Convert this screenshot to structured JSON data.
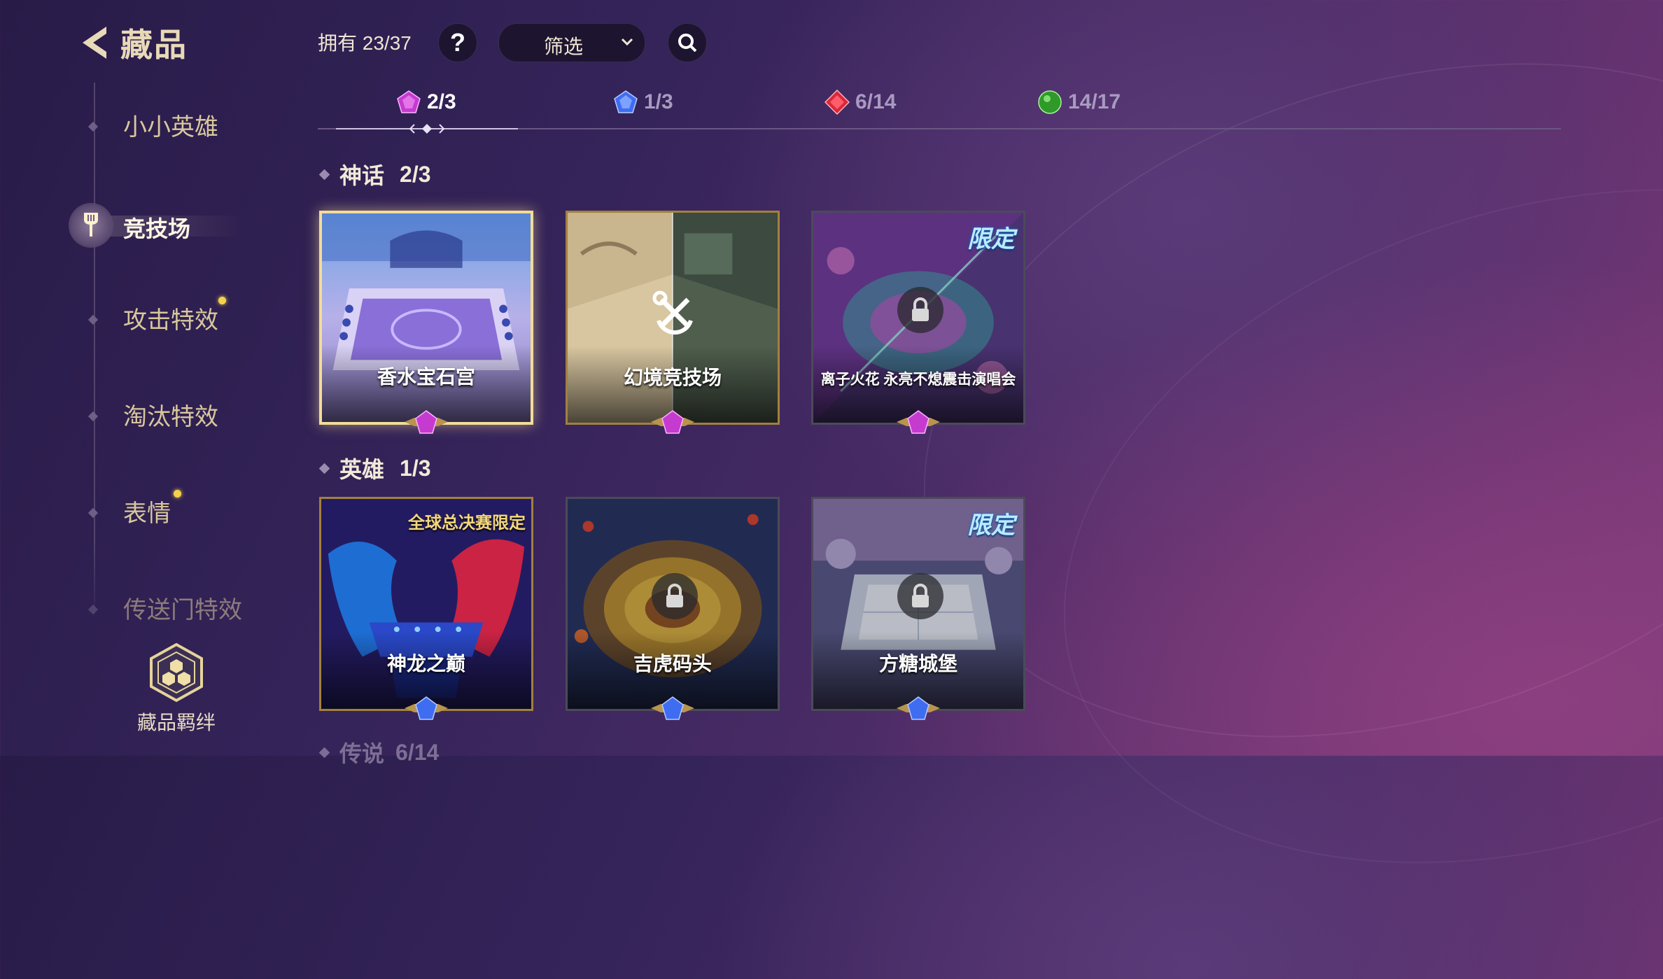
{
  "header": {
    "title": "藏品",
    "owned_label": "拥有 23/37",
    "filter_label": "筛选"
  },
  "sidebar": {
    "items": [
      {
        "label": "小小英雄"
      },
      {
        "label": "竞技场"
      },
      {
        "label": "攻击特效"
      },
      {
        "label": "淘汰特效"
      },
      {
        "label": "表情"
      },
      {
        "label": "传送门特效"
      }
    ],
    "bond_label": "藏品羁绊"
  },
  "rarity_tabs": [
    {
      "count": "2/3",
      "gem": "purple-gem-icon",
      "color": "#c53bd0"
    },
    {
      "count": "1/3",
      "gem": "blue-gem-icon",
      "color": "#3f6df2"
    },
    {
      "count": "6/14",
      "gem": "red-gem-icon",
      "color": "#d8283a"
    },
    {
      "count": "14/17",
      "gem": "green-gem-icon",
      "color": "#2f9a2a"
    }
  ],
  "sections": [
    {
      "title": "神话",
      "count": "2/3",
      "cards": [
        {
          "name": "香水宝石宫"
        },
        {
          "name": "幻境竞技场"
        },
        {
          "name": "离子火花 永亮不熄震击演唱会",
          "tag": "限定"
        }
      ]
    },
    {
      "title": "英雄",
      "count": "1/3",
      "cards": [
        {
          "name": "神龙之巅",
          "tag": "全球总决赛限定"
        },
        {
          "name": "吉虎码头"
        },
        {
          "name": "方糖城堡",
          "tag": "限定"
        }
      ]
    },
    {
      "title": "传说",
      "count": "6/14"
    }
  ]
}
